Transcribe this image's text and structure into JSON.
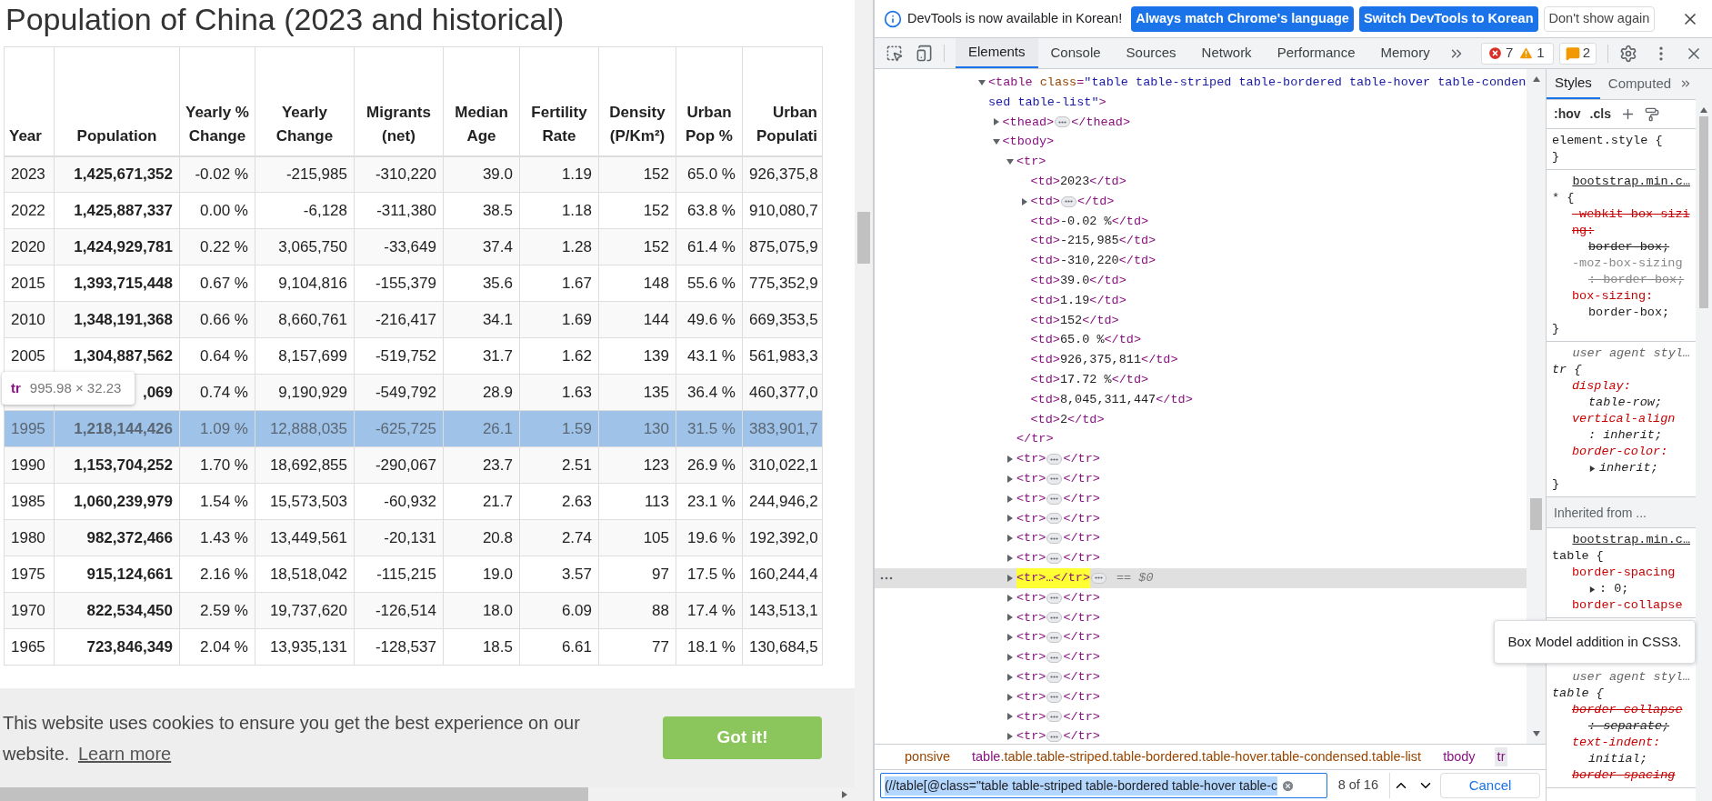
{
  "page": {
    "title": "Population of China (2023 and historical)",
    "table": {
      "columns": [
        "Year",
        "Population",
        "Yearly % Change",
        "Yearly Change",
        "Migrants (net)",
        "Median Age",
        "Fertility Rate",
        "Density (P/Km²)",
        "Urban Pop %",
        "Urban Populati"
      ],
      "rows": [
        {
          "highlighted": false,
          "cells": [
            "2023",
            "1,425,671,352",
            "-0.02 %",
            "-215,985",
            "-310,220",
            "39.0",
            "1.19",
            "152",
            "65.0 %",
            "926,375,8"
          ]
        },
        {
          "highlighted": false,
          "cells": [
            "2022",
            "1,425,887,337",
            "0.00 %",
            "-6,128",
            "-311,380",
            "38.5",
            "1.18",
            "152",
            "63.8 %",
            "910,080,7"
          ]
        },
        {
          "highlighted": false,
          "cells": [
            "2020",
            "1,424,929,781",
            "0.22 %",
            "3,065,750",
            "-33,649",
            "37.4",
            "1.28",
            "152",
            "61.4 %",
            "875,075,9"
          ]
        },
        {
          "highlighted": false,
          "cells": [
            "2015",
            "1,393,715,448",
            "0.67 %",
            "9,104,816",
            "-155,379",
            "35.6",
            "1.67",
            "148",
            "55.6 %",
            "775,352,9"
          ]
        },
        {
          "highlighted": false,
          "cells": [
            "2010",
            "1,348,191,368",
            "0.66 %",
            "8,660,761",
            "-216,417",
            "34.1",
            "1.69",
            "144",
            "49.6 %",
            "669,353,5"
          ]
        },
        {
          "highlighted": false,
          "cells": [
            "2005",
            "1,304,887,562",
            "0.64 %",
            "8,157,699",
            "-519,752",
            "31.7",
            "1.62",
            "139",
            "43.1 %",
            "561,983,3"
          ]
        },
        {
          "highlighted": false,
          "cells": [
            null,
            ",069",
            "0.74 %",
            "9,190,929",
            "-549,792",
            "28.9",
            "1.63",
            "135",
            "36.4 %",
            "460,377,0"
          ]
        },
        {
          "highlighted": true,
          "cells": [
            "1995",
            "1,218,144,426",
            "1.09 %",
            "12,888,035",
            "-625,725",
            "26.1",
            "1.59",
            "130",
            "31.5 %",
            "383,901,7"
          ]
        },
        {
          "highlighted": false,
          "cells": [
            "1990",
            "1,153,704,252",
            "1.70 %",
            "18,692,855",
            "-290,067",
            "23.7",
            "2.51",
            "123",
            "26.9 %",
            "310,022,1"
          ]
        },
        {
          "highlighted": false,
          "cells": [
            "1985",
            "1,060,239,979",
            "1.54 %",
            "15,573,503",
            "-60,932",
            "21.7",
            "2.63",
            "113",
            "23.1 %",
            "244,946,2"
          ]
        },
        {
          "highlighted": false,
          "cells": [
            "1980",
            "982,372,466",
            "1.43 %",
            "13,449,561",
            "-20,131",
            "20.8",
            "2.74",
            "105",
            "19.6 %",
            "192,392,0"
          ]
        },
        {
          "highlighted": false,
          "cells": [
            "1975",
            "915,124,661",
            "2.16 %",
            "18,518,042",
            "-115,215",
            "19.0",
            "3.57",
            "97",
            "17.5 %",
            "160,244,4"
          ]
        },
        {
          "highlighted": false,
          "cells": [
            "1970",
            "822,534,450",
            "2.59 %",
            "19,737,620",
            "-126,514",
            "18.0",
            "6.09",
            "88",
            "17.4 %",
            "143,513,1"
          ]
        },
        {
          "highlighted": false,
          "cells": [
            "1965",
            "723,846,349",
            "2.04 %",
            "13,935,131",
            "-128,537",
            "18.5",
            "6.61",
            "77",
            "18.1 %",
            "130,684,5"
          ]
        }
      ]
    },
    "row_tooltip": {
      "tag": "tr",
      "size": "995.98 × 32.23"
    },
    "cookie_banner": {
      "message": "This website uses cookies to ensure you get the best experience on our website.",
      "link": "Learn more",
      "button": "Got it!"
    }
  },
  "devtools": {
    "infobar": {
      "message": "DevTools is now available in Korean!",
      "buttons": [
        {
          "label": "Always match Chrome's language",
          "kind": "primary"
        },
        {
          "label": "Switch DevTools to Korean",
          "kind": "primary"
        },
        {
          "label": "Don't show again",
          "kind": "secondary"
        }
      ]
    },
    "tabs": [
      {
        "label": "Elements",
        "selected": true
      },
      {
        "label": "Console",
        "selected": false
      },
      {
        "label": "Sources",
        "selected": false
      },
      {
        "label": "Network",
        "selected": false
      },
      {
        "label": "Performance",
        "selected": false
      },
      {
        "label": "Memory",
        "selected": false
      }
    ],
    "counters": [
      {
        "kind": "error",
        "count": "7"
      },
      {
        "kind": "warning",
        "count": "1"
      },
      {
        "kind": "issue",
        "count": "2"
      }
    ],
    "tree": [
      {
        "open": [
          {
            "kind": "tag",
            "text": "<table "
          },
          {
            "kind": "attr",
            "text": "class"
          },
          {
            "kind": "tag",
            "text": "="
          },
          {
            "kind": "value",
            "text": "\"table table-striped table-bordered table-hover table-condensed table-list\""
          },
          {
            "kind": "tag",
            "text": ">"
          }
        ],
        "expanded": true,
        "selected": false,
        "children": [
          {
            "open": [
              {
                "kind": "tag",
                "text": "<thead>"
              }
            ],
            "close": [
              {
                "kind": "tag",
                "text": "</thead>"
              }
            ],
            "expanded": false,
            "selected": false
          },
          {
            "open": [
              {
                "kind": "tag",
                "text": "<tbody>"
              }
            ],
            "expanded": true,
            "selected": false,
            "children": [
              {
                "open": [
                  {
                    "kind": "tag",
                    "text": "<tr>"
                  }
                ],
                "close": [
                  {
                    "kind": "tag",
                    "text": "</tr>"
                  }
                ],
                "expanded": true,
                "selected": false,
                "match": false,
                "children": [
                  {
                    "open": [
                      {
                        "kind": "tag",
                        "text": "<td>"
                      },
                      {
                        "kind": "text",
                        "text": "2023"
                      },
                      {
                        "kind": "tag",
                        "text": "</td>"
                      }
                    ],
                    "selected": false
                  },
                  {
                    "open": [
                      {
                        "kind": "tag",
                        "text": "<td>"
                      }
                    ],
                    "close": [
                      {
                        "kind": "tag",
                        "text": "</td>"
                      }
                    ],
                    "expanded": false,
                    "selected": false
                  },
                  {
                    "open": [
                      {
                        "kind": "tag",
                        "text": "<td>"
                      },
                      {
                        "kind": "text",
                        "text": "-0.02 %"
                      },
                      {
                        "kind": "tag",
                        "text": "</td>"
                      }
                    ],
                    "selected": false
                  },
                  {
                    "open": [
                      {
                        "kind": "tag",
                        "text": "<td>"
                      },
                      {
                        "kind": "text",
                        "text": "-215,985"
                      },
                      {
                        "kind": "tag",
                        "text": "</td>"
                      }
                    ],
                    "selected": false
                  },
                  {
                    "open": [
                      {
                        "kind": "tag",
                        "text": "<td>"
                      },
                      {
                        "kind": "text",
                        "text": "-310,220"
                      },
                      {
                        "kind": "tag",
                        "text": "</td>"
                      }
                    ],
                    "selected": false
                  },
                  {
                    "open": [
                      {
                        "kind": "tag",
                        "text": "<td>"
                      },
                      {
                        "kind": "text",
                        "text": "39.0"
                      },
                      {
                        "kind": "tag",
                        "text": "</td>"
                      }
                    ],
                    "selected": false
                  },
                  {
                    "open": [
                      {
                        "kind": "tag",
                        "text": "<td>"
                      },
                      {
                        "kind": "text",
                        "text": "1.19"
                      },
                      {
                        "kind": "tag",
                        "text": "</td>"
                      }
                    ],
                    "selected": false
                  },
                  {
                    "open": [
                      {
                        "kind": "tag",
                        "text": "<td>"
                      },
                      {
                        "kind": "text",
                        "text": "152"
                      },
                      {
                        "kind": "tag",
                        "text": "</td>"
                      }
                    ],
                    "selected": false
                  },
                  {
                    "open": [
                      {
                        "kind": "tag",
                        "text": "<td>"
                      },
                      {
                        "kind": "text",
                        "text": "65.0 %"
                      },
                      {
                        "kind": "tag",
                        "text": "</td>"
                      }
                    ],
                    "selected": false
                  },
                  {
                    "open": [
                      {
                        "kind": "tag",
                        "text": "<td>"
                      },
                      {
                        "kind": "text",
                        "text": "926,375,811"
                      },
                      {
                        "kind": "tag",
                        "text": "</td>"
                      }
                    ],
                    "selected": false
                  },
                  {
                    "open": [
                      {
                        "kind": "tag",
                        "text": "<td>"
                      },
                      {
                        "kind": "text",
                        "text": "17.72 %"
                      },
                      {
                        "kind": "tag",
                        "text": "</td>"
                      }
                    ],
                    "selected": false
                  },
                  {
                    "open": [
                      {
                        "kind": "tag",
                        "text": "<td>"
                      },
                      {
                        "kind": "text",
                        "text": "8,045,311,447"
                      },
                      {
                        "kind": "tag",
                        "text": "</td>"
                      }
                    ],
                    "selected": false
                  },
                  {
                    "open": [
                      {
                        "kind": "tag",
                        "text": "<td>"
                      },
                      {
                        "kind": "text",
                        "text": "2"
                      },
                      {
                        "kind": "tag",
                        "text": "</td>"
                      }
                    ],
                    "selected": false
                  }
                ]
              },
              {
                "open": [
                  {
                    "kind": "tag",
                    "text": "<tr>"
                  }
                ],
                "close": [
                  {
                    "kind": "tag",
                    "text": "</tr>"
                  }
                ],
                "expanded": false,
                "selected": false,
                "match": false
              },
              {
                "open": [
                  {
                    "kind": "tag",
                    "text": "<tr>"
                  }
                ],
                "close": [
                  {
                    "kind": "tag",
                    "text": "</tr>"
                  }
                ],
                "expanded": false,
                "selected": false,
                "match": false
              },
              {
                "open": [
                  {
                    "kind": "tag",
                    "text": "<tr>"
                  }
                ],
                "close": [
                  {
                    "kind": "tag",
                    "text": "</tr>"
                  }
                ],
                "expanded": false,
                "selected": false,
                "match": false
              },
              {
                "open": [
                  {
                    "kind": "tag",
                    "text": "<tr>"
                  }
                ],
                "close": [
                  {
                    "kind": "tag",
                    "text": "</tr>"
                  }
                ],
                "expanded": false,
                "selected": false,
                "match": false
              },
              {
                "open": [
                  {
                    "kind": "tag",
                    "text": "<tr>"
                  }
                ],
                "close": [
                  {
                    "kind": "tag",
                    "text": "</tr>"
                  }
                ],
                "expanded": false,
                "selected": false,
                "match": false
              },
              {
                "open": [
                  {
                    "kind": "tag",
                    "text": "<tr>"
                  }
                ],
                "close": [
                  {
                    "kind": "tag",
                    "text": "</tr>"
                  }
                ],
                "expanded": false,
                "selected": false,
                "match": false
              },
              {
                "open": [
                  {
                    "kind": "tag",
                    "text": "<tr>…</tr>"
                  }
                ],
                "expanded": false,
                "selected": true,
                "match": true,
                "console_ref": "== $0"
              },
              {
                "open": [
                  {
                    "kind": "tag",
                    "text": "<tr>"
                  }
                ],
                "close": [
                  {
                    "kind": "tag",
                    "text": "</tr>"
                  }
                ],
                "expanded": false,
                "selected": false,
                "match": false
              },
              {
                "open": [
                  {
                    "kind": "tag",
                    "text": "<tr>"
                  }
                ],
                "close": [
                  {
                    "kind": "tag",
                    "text": "</tr>"
                  }
                ],
                "expanded": false,
                "selected": false,
                "match": false
              },
              {
                "open": [
                  {
                    "kind": "tag",
                    "text": "<tr>"
                  }
                ],
                "close": [
                  {
                    "kind": "tag",
                    "text": "</tr>"
                  }
                ],
                "expanded": false,
                "selected": false,
                "match": false
              },
              {
                "open": [
                  {
                    "kind": "tag",
                    "text": "<tr>"
                  }
                ],
                "close": [
                  {
                    "kind": "tag",
                    "text": "</tr>"
                  }
                ],
                "expanded": false,
                "selected": false,
                "match": false
              },
              {
                "open": [
                  {
                    "kind": "tag",
                    "text": "<tr>"
                  }
                ],
                "close": [
                  {
                    "kind": "tag",
                    "text": "</tr>"
                  }
                ],
                "expanded": false,
                "selected": false,
                "match": false
              },
              {
                "open": [
                  {
                    "kind": "tag",
                    "text": "<tr>"
                  }
                ],
                "close": [
                  {
                    "kind": "tag",
                    "text": "</tr>"
                  }
                ],
                "expanded": false,
                "selected": false,
                "match": false
              },
              {
                "open": [
                  {
                    "kind": "tag",
                    "text": "<tr>"
                  }
                ],
                "close": [
                  {
                    "kind": "tag",
                    "text": "</tr>"
                  }
                ],
                "expanded": false,
                "selected": false,
                "match": false
              },
              {
                "open": [
                  {
                    "kind": "tag",
                    "text": "<tr>"
                  }
                ],
                "close": [
                  {
                    "kind": "tag",
                    "text": "</tr>"
                  }
                ],
                "expanded": false,
                "selected": false,
                "match": false
              }
            ]
          }
        ]
      }
    ],
    "breadcrumbs": [
      {
        "classes": "ponsive",
        "selected": false
      },
      {
        "tag": "table",
        "classes": ".table.table-striped.table-bordered.table-hover.table-condensed.table-list",
        "selected": false
      },
      {
        "tag": "tbody",
        "selected": false
      },
      {
        "tag": "tr",
        "selected": true
      }
    ],
    "search": {
      "value": "(//table[@class=\"table table-striped table-bordered table-hover table-c",
      "result": "8 of 16",
      "cancel": "Cancel"
    },
    "styles": {
      "tabs": [
        {
          "label": "Styles",
          "selected": true
        },
        {
          "label": "Computed",
          "selected": false
        }
      ],
      "toolbar": [
        ":hov",
        ".cls"
      ],
      "rules": [
        {
          "kind": "rule",
          "user_agent": false,
          "selector": "element.style {",
          "close": "}"
        },
        {
          "kind": "rule",
          "user_agent": false,
          "source": "bootstrap.min.c…",
          "selector": "* {",
          "close": "}",
          "properties": [
            {
              "name": "-webkit-box-sizing:",
              "value": "border-box;",
              "overridden": true,
              "invalid": false
            },
            {
              "name": "-moz-box-sizing",
              "value": ": border-box;",
              "overridden": false,
              "invalid": true
            },
            {
              "name": "box-sizing:",
              "value": "border-box;",
              "overridden": false,
              "invalid": false
            }
          ]
        },
        {
          "kind": "rule",
          "user_agent": true,
          "source": "user agent styl…",
          "selector": "tr {",
          "close": "}",
          "properties": [
            {
              "name": "display:",
              "value": "table-row;",
              "overridden": false,
              "invalid": false
            },
            {
              "name": "vertical-align",
              "value": ": inherit;",
              "overridden": false,
              "invalid": false
            },
            {
              "name": "border-color:",
              "value": "inherit;",
              "overridden": false,
              "invalid": false,
              "expandable": true
            }
          ]
        },
        {
          "kind": "header",
          "text": "Inherited from ..."
        },
        {
          "kind": "rule",
          "user_agent": false,
          "source": "bootstrap.min.c…",
          "selector": "table {",
          "properties": [
            {
              "name": "border-spacing",
              "value": ": 0;",
              "overridden": false,
              "invalid": false,
              "expandable": true
            },
            {
              "name": "border-collapse",
              "overridden": false,
              "invalid": false
            }
          ]
        },
        {
          "kind": "tooltip",
          "text": "Box Model addition in CSS3."
        },
        {
          "kind": "rule",
          "user_agent": true,
          "source": "user agent styl…",
          "selector": "table {",
          "properties": [
            {
              "name": "border-collapse",
              "value": ": separate;",
              "overridden": true,
              "invalid": false
            },
            {
              "name": "text-indent:",
              "value": "initial;",
              "overridden": false,
              "invalid": false
            },
            {
              "name": "border-spacing",
              "overridden": true,
              "invalid": false
            }
          ]
        }
      ]
    }
  }
}
